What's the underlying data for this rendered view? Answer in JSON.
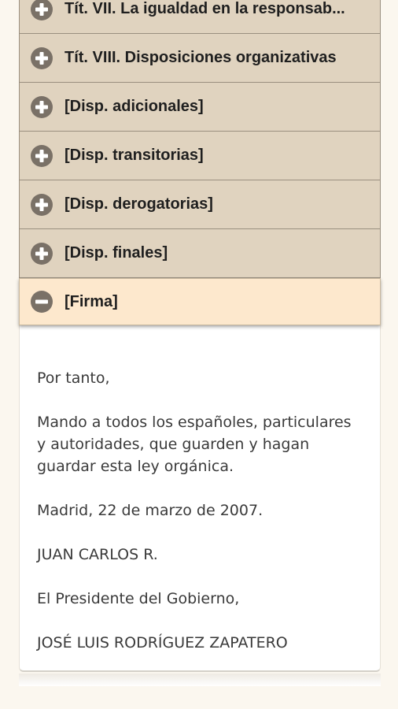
{
  "accordion": {
    "items": [
      {
        "label": "Tít. VII. La igualdad en la responsab...",
        "icon": "plus-circle-icon",
        "expanded": false
      },
      {
        "label": "Tít. VIII. Disposiciones organizativas",
        "icon": "plus-circle-icon",
        "expanded": false
      },
      {
        "label": "[Disp. adicionales]",
        "icon": "plus-circle-icon",
        "expanded": false
      },
      {
        "label": "[Disp. transitorias]",
        "icon": "plus-circle-icon",
        "expanded": false
      },
      {
        "label": "[Disp. derogatorias]",
        "icon": "plus-circle-icon",
        "expanded": false
      },
      {
        "label": "[Disp. finales]",
        "icon": "plus-circle-icon",
        "expanded": false
      },
      {
        "label": "[Firma]",
        "icon": "minus-circle-icon",
        "expanded": true
      }
    ]
  },
  "firma_content": {
    "paragraphs": [
      "Por tanto,",
      "Mando a todos los españoles, particulares y autoridades, que guarden y hagan guardar esta ley orgánica.",
      "Madrid, 22 de marzo de 2007.",
      "JUAN CARLOS R.",
      "El Presidente del Gobierno,",
      "JOSÉ LUIS RODRÍGUEZ ZAPATERO"
    ]
  },
  "colors": {
    "collapsed_header": "#e0d3bf",
    "expanded_header": "#fde8cd",
    "icon_fill": "#7a7167",
    "background": "#fbf7ef"
  }
}
